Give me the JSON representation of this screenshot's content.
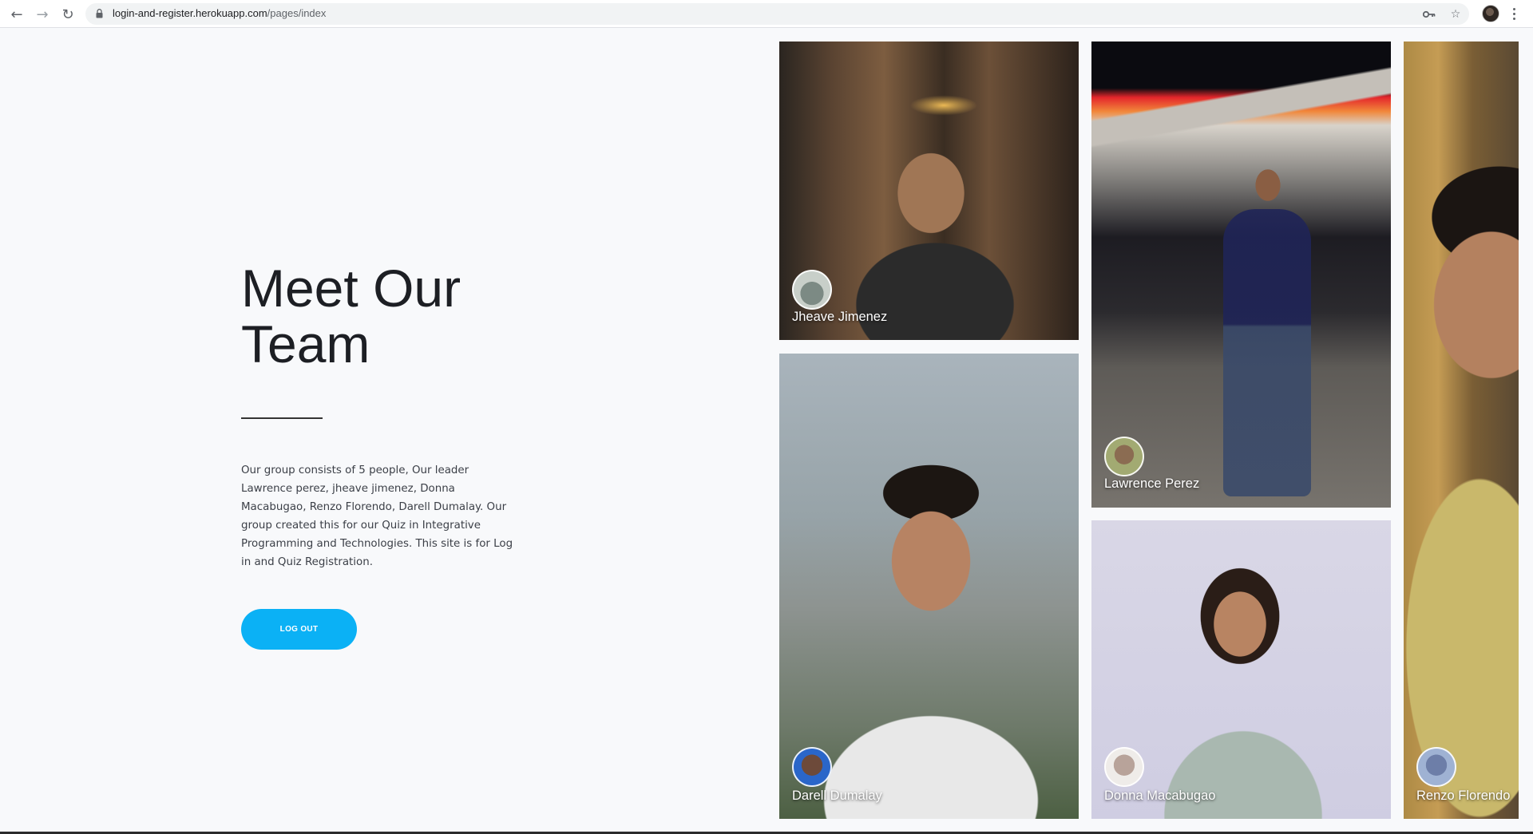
{
  "browser": {
    "url_host": "login-and-register.herokuapp.com",
    "url_path": "/pages/index",
    "icons": [
      "back-icon",
      "forward-icon",
      "reload-icon",
      "lock-icon",
      "key-icon",
      "star-icon",
      "profile-avatar",
      "menu-icon"
    ]
  },
  "hero": {
    "title_line1": "Meet Our",
    "title_line2": "Team",
    "description": "Our group consists of 5 people, Our leader Lawrence perez, jheave jimenez, Donna Macabugao, Renzo Florendo, Darell Dumalay. Our group created this for our Quiz in Integrative Programming and Technologies. This site is for Log in and Quiz Registration.",
    "logout_label": "LOG OUT",
    "accent_color": "#0bb1f5"
  },
  "team": [
    {
      "name": "Jheave Jimenez"
    },
    {
      "name": "Lawrence Perez"
    },
    {
      "name": "Darell Dumalay"
    },
    {
      "name": "Donna Macabugao"
    },
    {
      "name": "Renzo Florendo"
    }
  ]
}
